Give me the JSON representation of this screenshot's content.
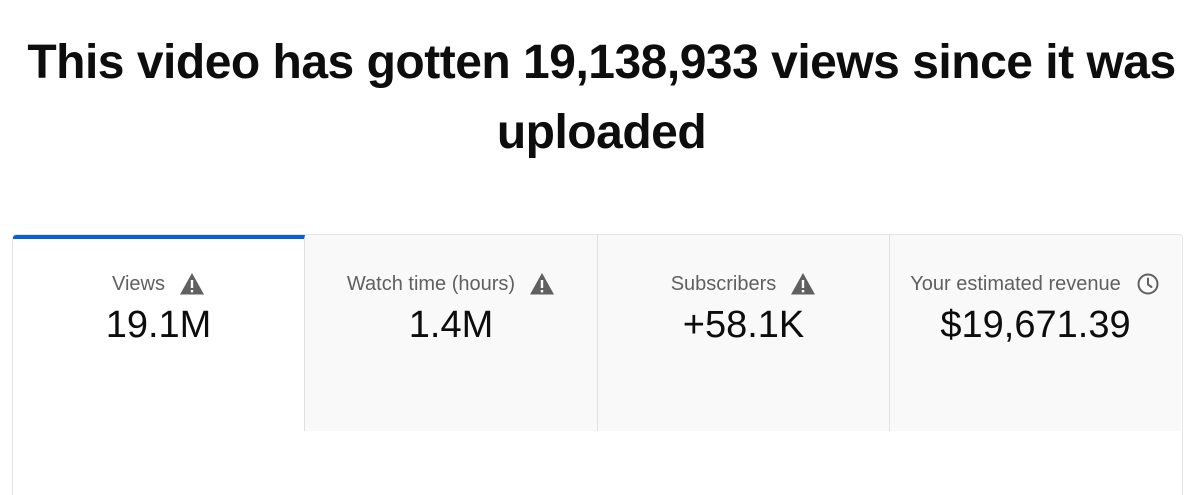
{
  "headline": {
    "line1": "This video has gotten 19,138,933 views since it was",
    "line2": "uploaded"
  },
  "metrics": [
    {
      "label": "Views",
      "value": "19.1M",
      "icon": "warning-icon",
      "selected": true
    },
    {
      "label": "Watch time (hours)",
      "value": "1.4M",
      "icon": "warning-icon",
      "selected": false
    },
    {
      "label": "Subscribers",
      "value": "+58.1K",
      "icon": "warning-icon",
      "selected": false
    },
    {
      "label": "Your estimated revenue",
      "value": "$19,671.39",
      "icon": "clock-icon",
      "selected": false
    }
  ],
  "colors": {
    "accent": "#065fd4",
    "icon": "#606060",
    "tab_background": "#f9f9f9"
  }
}
